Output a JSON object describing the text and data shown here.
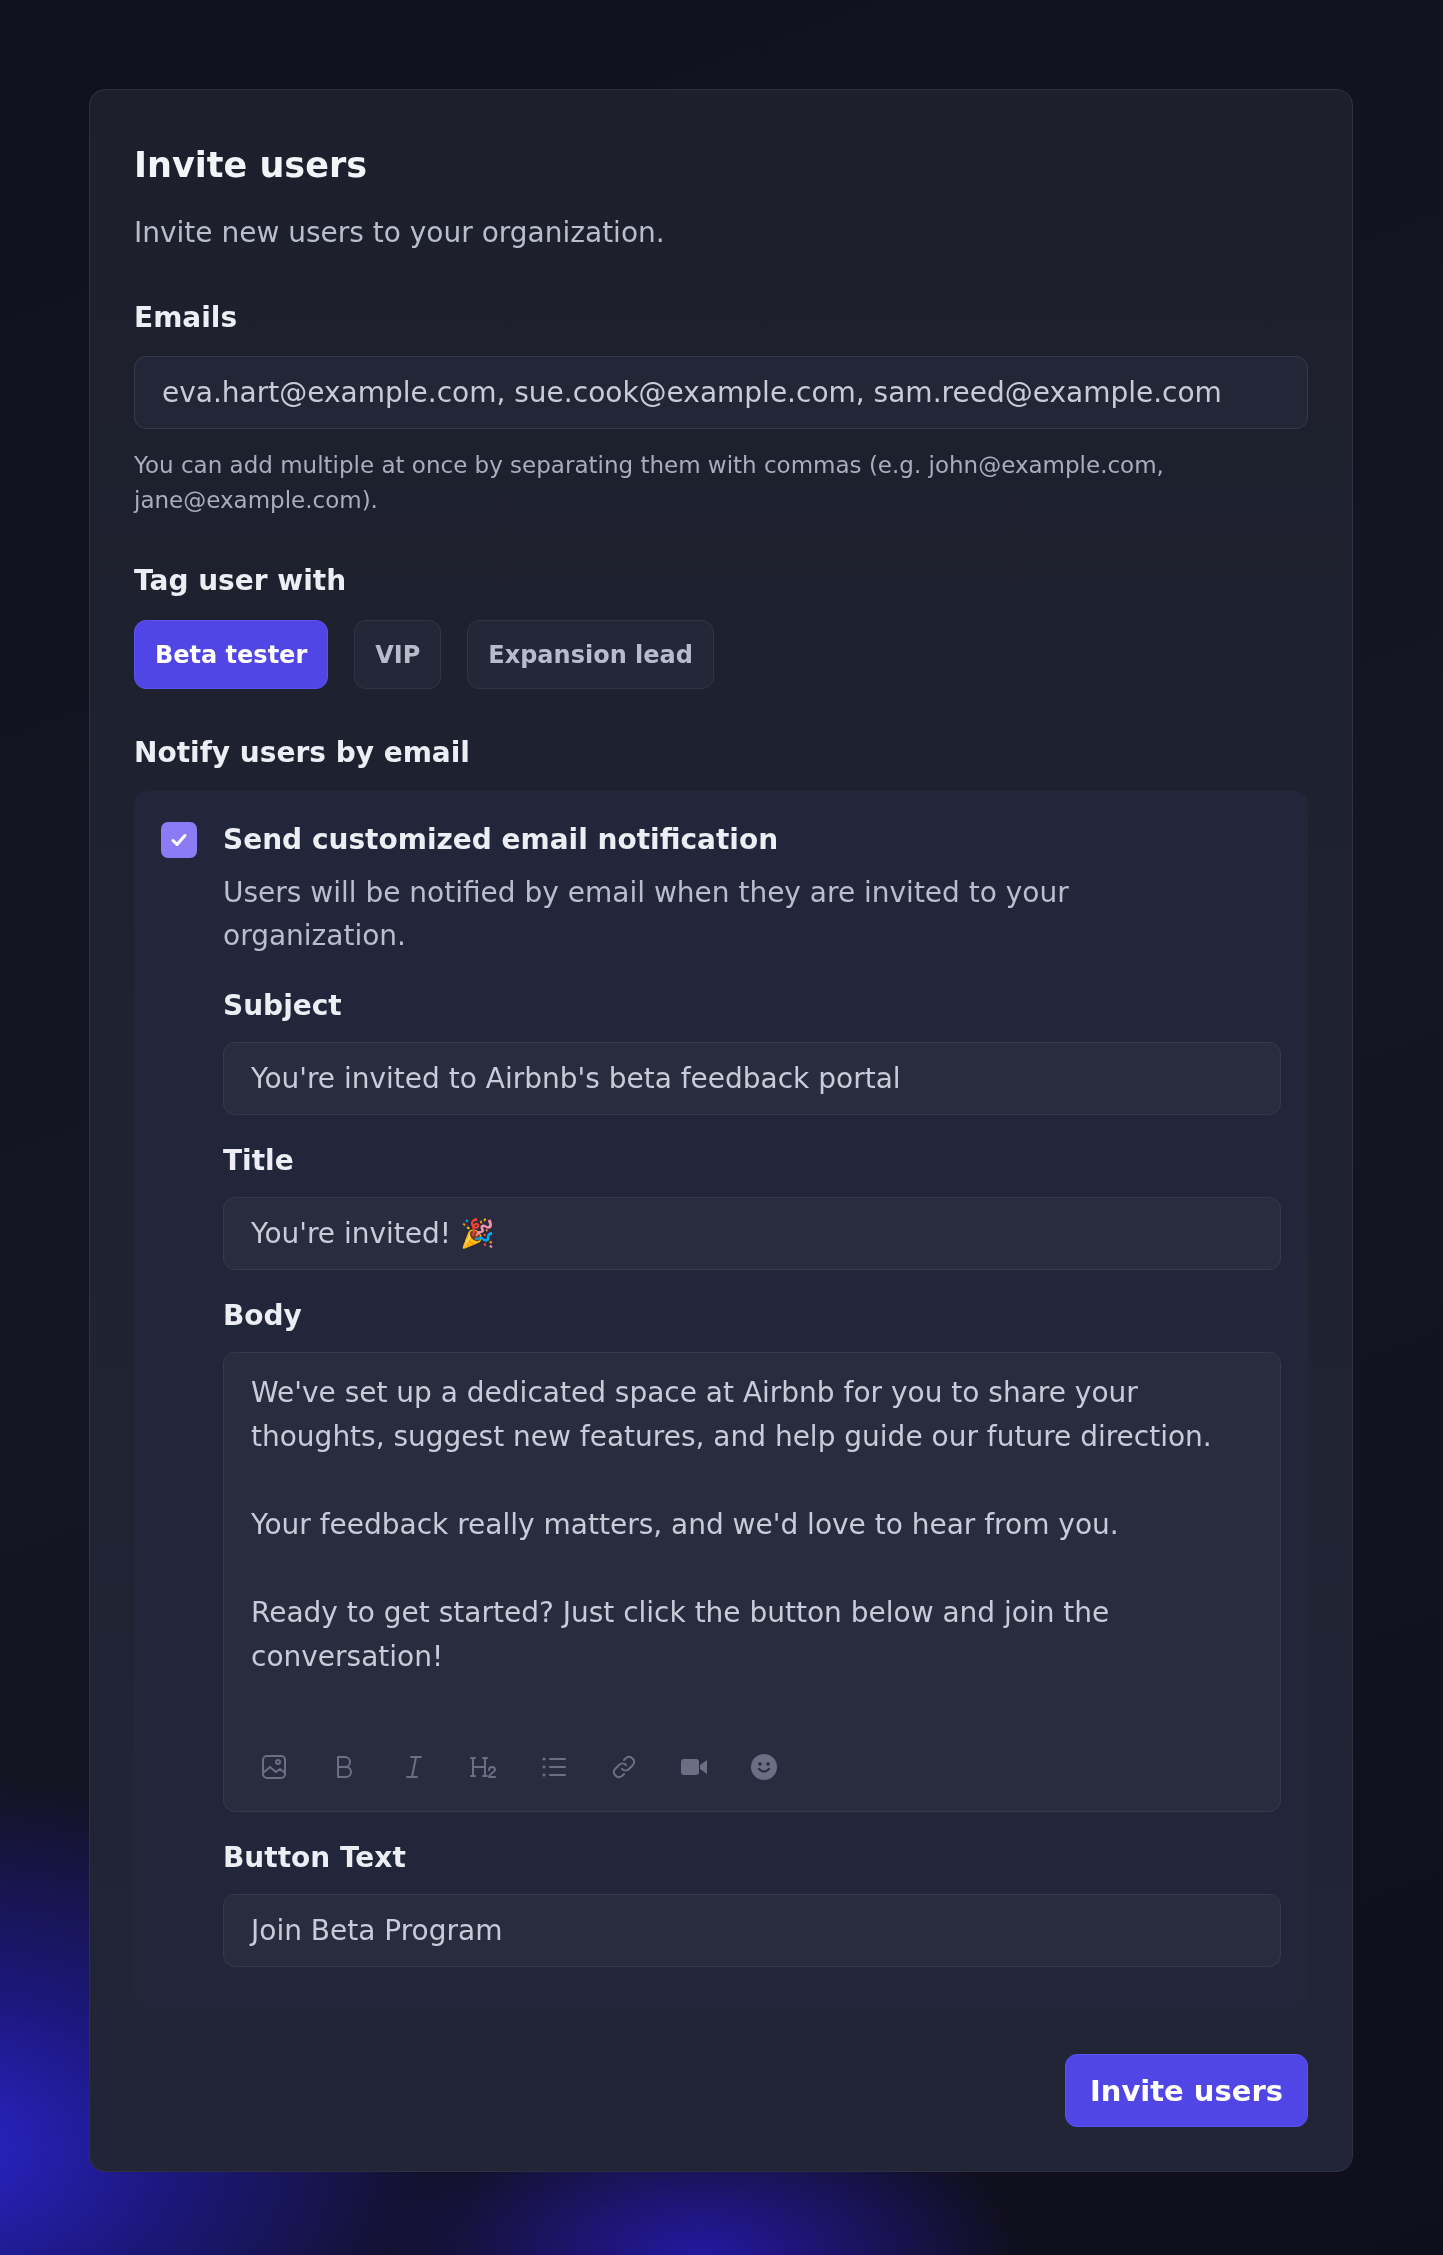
{
  "title": "Invite users",
  "subtitle": "Invite new users to your organization.",
  "emails": {
    "label": "Emails",
    "value": "eva.hart@example.com, sue.cook@example.com, sam.reed@example.com",
    "help": "You can add multiple at once by separating them with commas (e.g. john@example.com, jane@example.com)."
  },
  "tags": {
    "label": "Tag user with",
    "items": [
      {
        "label": "Beta tester",
        "selected": true
      },
      {
        "label": "VIP",
        "selected": false
      },
      {
        "label": "Expansion lead",
        "selected": false
      }
    ]
  },
  "notify": {
    "label": "Notify users by email",
    "checked": true,
    "option_label": "Send customized email notification",
    "option_description": "Users will be notified by email when they are invited to your organization.",
    "subject": {
      "label": "Subject",
      "value": "You're invited to Airbnb's beta feedback portal"
    },
    "title": {
      "label": "Title",
      "value": "You're invited! 🎉"
    },
    "body": {
      "label": "Body",
      "paragraphs": [
        "We've set up a dedicated space at Airbnb for you to share your thoughts, suggest new features, and help guide our future direction.",
        "Your feedback really matters, and we'd love to hear from you.",
        "Ready to get started? Just click the button below and join the conversation!"
      ],
      "toolbar": [
        {
          "kind": "image"
        },
        {
          "kind": "bold"
        },
        {
          "kind": "italic"
        },
        {
          "kind": "heading"
        },
        {
          "kind": "list"
        },
        {
          "kind": "link"
        },
        {
          "kind": "video"
        },
        {
          "kind": "emoji"
        }
      ]
    },
    "button_text": {
      "label": "Button Text",
      "value": "Join Beta Program"
    }
  },
  "submit": "Invite users"
}
